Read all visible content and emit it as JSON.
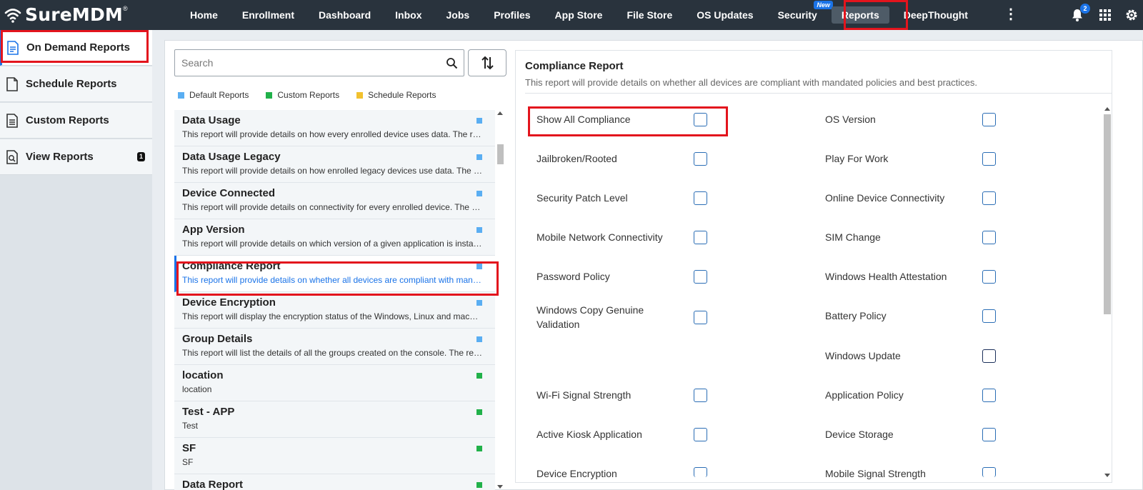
{
  "brand": {
    "name": "SureMDM",
    "reg": "®"
  },
  "nav": {
    "items": [
      {
        "label": "Home"
      },
      {
        "label": "Enrollment"
      },
      {
        "label": "Dashboard"
      },
      {
        "label": "Inbox"
      },
      {
        "label": "Jobs"
      },
      {
        "label": "Profiles"
      },
      {
        "label": "App Store"
      },
      {
        "label": "File Store"
      },
      {
        "label": "OS Updates"
      },
      {
        "label": "Security",
        "badge": "New"
      },
      {
        "label": "Reports",
        "active": true
      },
      {
        "label": "DeepThought"
      }
    ],
    "more_icon": "kebab-icon",
    "notification_count": "2",
    "icons": [
      "bell-icon",
      "apps-grid-icon",
      "gear-icon"
    ]
  },
  "sidebar": {
    "items": [
      {
        "label": "On Demand Reports",
        "icon": "report-doc-icon",
        "active": true
      },
      {
        "label": "Schedule Reports",
        "icon": "file-icon"
      },
      {
        "label": "Custom Reports",
        "icon": "list-doc-icon"
      },
      {
        "label": "View Reports",
        "icon": "search-doc-icon",
        "badge": "1"
      }
    ]
  },
  "report_list": {
    "search_placeholder": "Search",
    "legend": [
      {
        "label": "Default Reports",
        "color": "#5aaef2"
      },
      {
        "label": "Custom Reports",
        "color": "#21b14a"
      },
      {
        "label": "Schedule Reports",
        "color": "#f2c12e"
      }
    ],
    "items": [
      {
        "title": "Data Usage",
        "desc": "This report will provide details on how every enrolled device uses data. The report includes details like data usage, device name and more.",
        "type": "default"
      },
      {
        "title": "Data Usage Legacy",
        "desc": "This report will provide details on how enrolled legacy devices use data. The report includes details like data usage and more.",
        "type": "default"
      },
      {
        "title": "Device Connected",
        "desc": "This report will provide details on connectivity for every enrolled device. The report includes details like last connected time.",
        "type": "default"
      },
      {
        "title": "App Version",
        "desc": "This report will provide details on which version of a given application is installed on every enrolled device.",
        "type": "default"
      },
      {
        "title": "Compliance Report",
        "desc": "This report will provide details on whether all devices are compliant with mandated policies and best practices.",
        "type": "default",
        "selected": true
      },
      {
        "title": "Device Encryption",
        "desc": "This report will display the encryption status of the Windows, Linux and macOS devices enrolled on the console.",
        "type": "default"
      },
      {
        "title": "Group Details",
        "desc": "This report will list the details of all the groups created on the console. The report includes group name and more.",
        "type": "default"
      },
      {
        "title": "location",
        "desc": "location",
        "type": "custom"
      },
      {
        "title": "Test - APP",
        "desc": "Test",
        "type": "custom"
      },
      {
        "title": "SF",
        "desc": "SF",
        "type": "custom"
      },
      {
        "title": "Data Report",
        "desc": "",
        "type": "custom"
      }
    ]
  },
  "compliance": {
    "title": "Compliance Report",
    "desc": "This report will provide details on whether all devices are compliant with mandated policies and best practices.",
    "left_options": [
      "Show All Compliance",
      "Jailbroken/Rooted",
      "Security Patch Level",
      "Mobile Network Connectivity",
      "Password Policy",
      "Windows Copy Genuine Validation",
      "Wi-Fi Signal Strength",
      "Active Kiosk Application",
      "Device Encryption"
    ],
    "right_options": [
      "OS Version",
      "Play For Work",
      "Online Device Connectivity",
      "SIM Change",
      "Windows Health Attestation",
      "Battery Policy",
      "Windows Update",
      "Application Policy",
      "Device Storage",
      "Mobile Signal Strength"
    ]
  }
}
